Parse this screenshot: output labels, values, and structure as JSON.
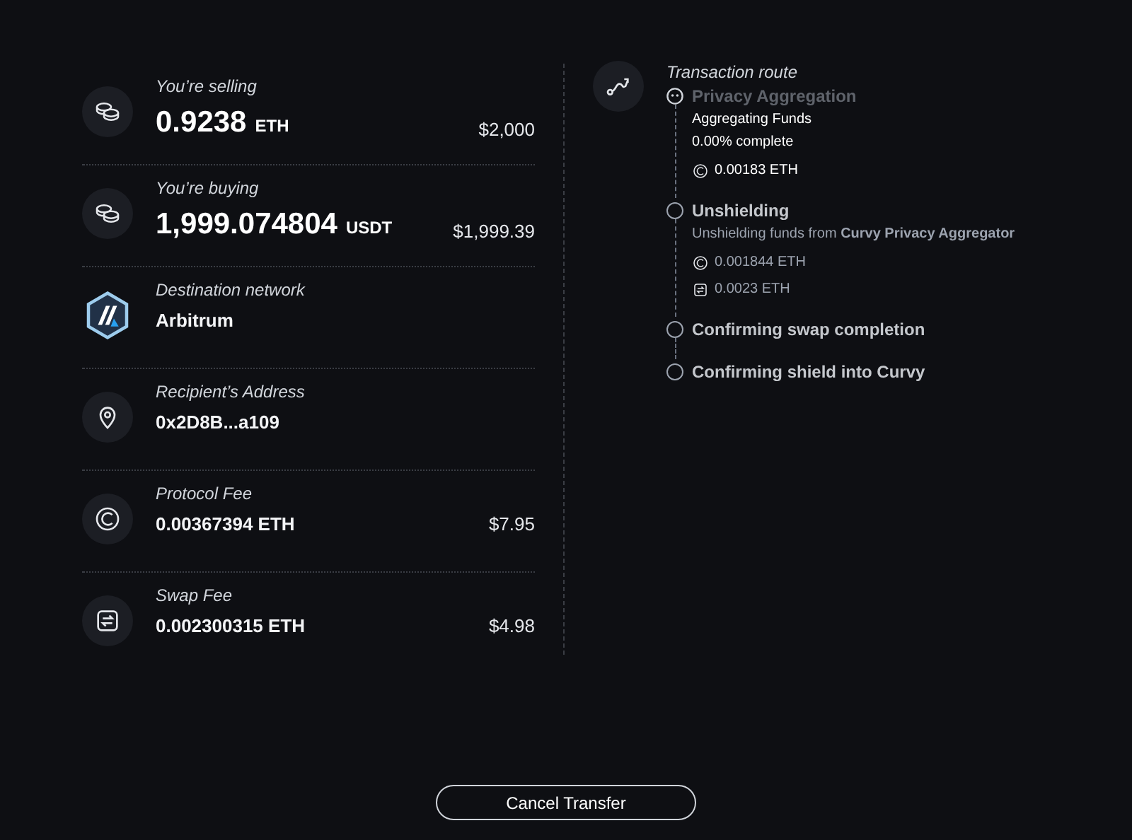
{
  "details": [
    {
      "kind": "coins",
      "label": "You’re selling",
      "amount": "0.9238",
      "unit": "ETH",
      "fiat": "$2,000"
    },
    {
      "kind": "coins",
      "label": "You’re buying",
      "amount": "1,999.074804",
      "unit": "USDT",
      "fiat": "$1,999.39"
    },
    {
      "kind": "network",
      "label": "Destination network",
      "value": "Arbitrum"
    },
    {
      "kind": "address",
      "label": "Recipient’s Address",
      "value": "0x2D8B...a109"
    },
    {
      "kind": "protocol",
      "label": "Protocol Fee",
      "value": "0.00367394 ETH",
      "fiat": "$7.95"
    },
    {
      "kind": "swap",
      "label": "Swap Fee",
      "value": "0.002300315 ETH",
      "fiat": "$4.98"
    }
  ],
  "route": {
    "title": "Transaction route",
    "steps": [
      {
        "active": true,
        "title": "Privacy Aggregation",
        "lines": [
          {
            "kind": "text",
            "text": "Aggregating Funds"
          },
          {
            "kind": "text",
            "text": "0.00% complete"
          },
          {
            "kind": "protocol",
            "text": "0.00183 ETH"
          }
        ]
      },
      {
        "active": false,
        "title": "Unshielding",
        "lines": [
          {
            "kind": "text",
            "text": "Unshielding funds from **Curvy Privacy Aggregator**"
          },
          {
            "kind": "protocol",
            "text": "0.001844 ETH"
          },
          {
            "kind": "swap",
            "text": "0.0023 ETH"
          }
        ]
      },
      {
        "active": false,
        "title": "Confirming swap completion"
      },
      {
        "active": false,
        "title": "Confirming shield into Curvy"
      }
    ]
  },
  "cancel_button": "Cancel Transfer"
}
